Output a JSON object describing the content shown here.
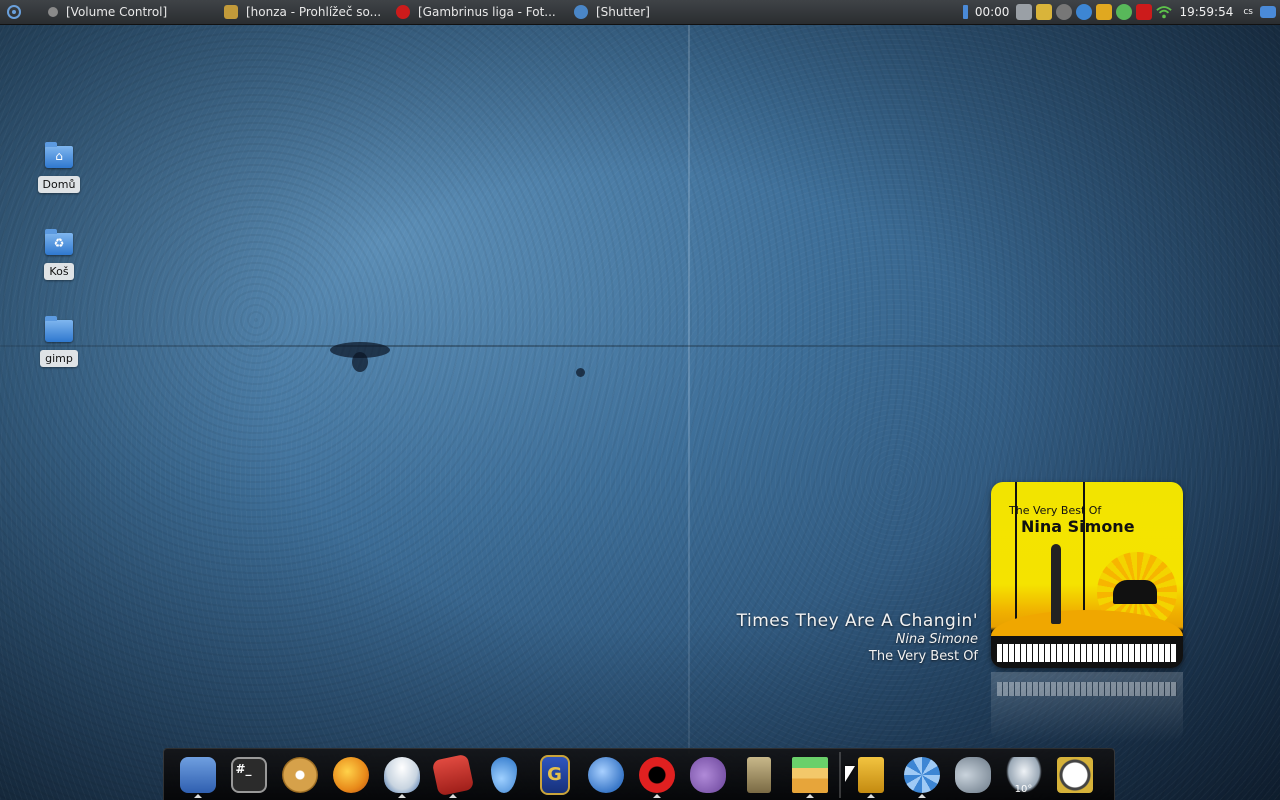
{
  "top_panel": {
    "tasks": [
      {
        "label": "[Volume Control]",
        "icon": "volume-control-icon",
        "color": "#8a8a8a"
      },
      {
        "label": "[honza - Prohlížeč so...",
        "icon": "file-browser-icon",
        "color": "#c29a3a"
      },
      {
        "label": "[Gambrinus liga - Fot...",
        "icon": "opera-icon",
        "color": "#cc1b1b"
      },
      {
        "label": "[Shutter]",
        "icon": "shutter-icon",
        "color": "#4a86c7"
      }
    ],
    "timer": "00:00",
    "clock": "19:59:54",
    "keyboard_layout": "cs"
  },
  "desktop_icons": [
    {
      "label": "Domů",
      "icon": "home-folder-icon"
    },
    {
      "label": "Koš",
      "icon": "trash-icon"
    },
    {
      "label": "gimp",
      "icon": "folder-icon"
    }
  ],
  "now_playing": {
    "title": "Times They Are A Changin'",
    "artist": "Nina Simone",
    "album": "The Very Best Of",
    "cover_line1": "The Very Best Of",
    "cover_line2": "Nina Simone"
  },
  "dock": {
    "weather_temp": "10°",
    "items": [
      {
        "name": "finder-icon",
        "color": "#3f73c9"
      },
      {
        "name": "terminal-icon",
        "color": "#2b2b2b",
        "glyph": "#_"
      },
      {
        "name": "disc-burner-icon",
        "color": "#d6a14a"
      },
      {
        "name": "firefox-icon",
        "color": "#e88a1a"
      },
      {
        "name": "hat-icon",
        "color": "#dfe7ef"
      },
      {
        "name": "presentation-icon",
        "color": "#c0302b"
      },
      {
        "name": "drop-icon",
        "color": "#3b8fe0"
      },
      {
        "name": "film-icon",
        "color": "#2446a6",
        "glyph": "G"
      },
      {
        "name": "thunderbird-icon",
        "color": "#4a8ad8"
      },
      {
        "name": "opera-icon",
        "color": "#cc1b1b",
        "glyph": "O"
      },
      {
        "name": "pidgin-icon",
        "color": "#7d5aa8"
      },
      {
        "name": "speaker-icon",
        "color": "#a8956a"
      },
      {
        "name": "equalizer-icon",
        "color": "#e7a53a"
      },
      {
        "name": "archive-icon",
        "color": "#e0a820"
      },
      {
        "name": "shutter-icon",
        "color": "#3d86d4"
      },
      {
        "name": "volume-icon",
        "color": "#8c9aa8"
      },
      {
        "name": "weather-icon",
        "color": "#9aa8b6"
      },
      {
        "name": "clock-icon",
        "color": "#555555"
      }
    ]
  }
}
